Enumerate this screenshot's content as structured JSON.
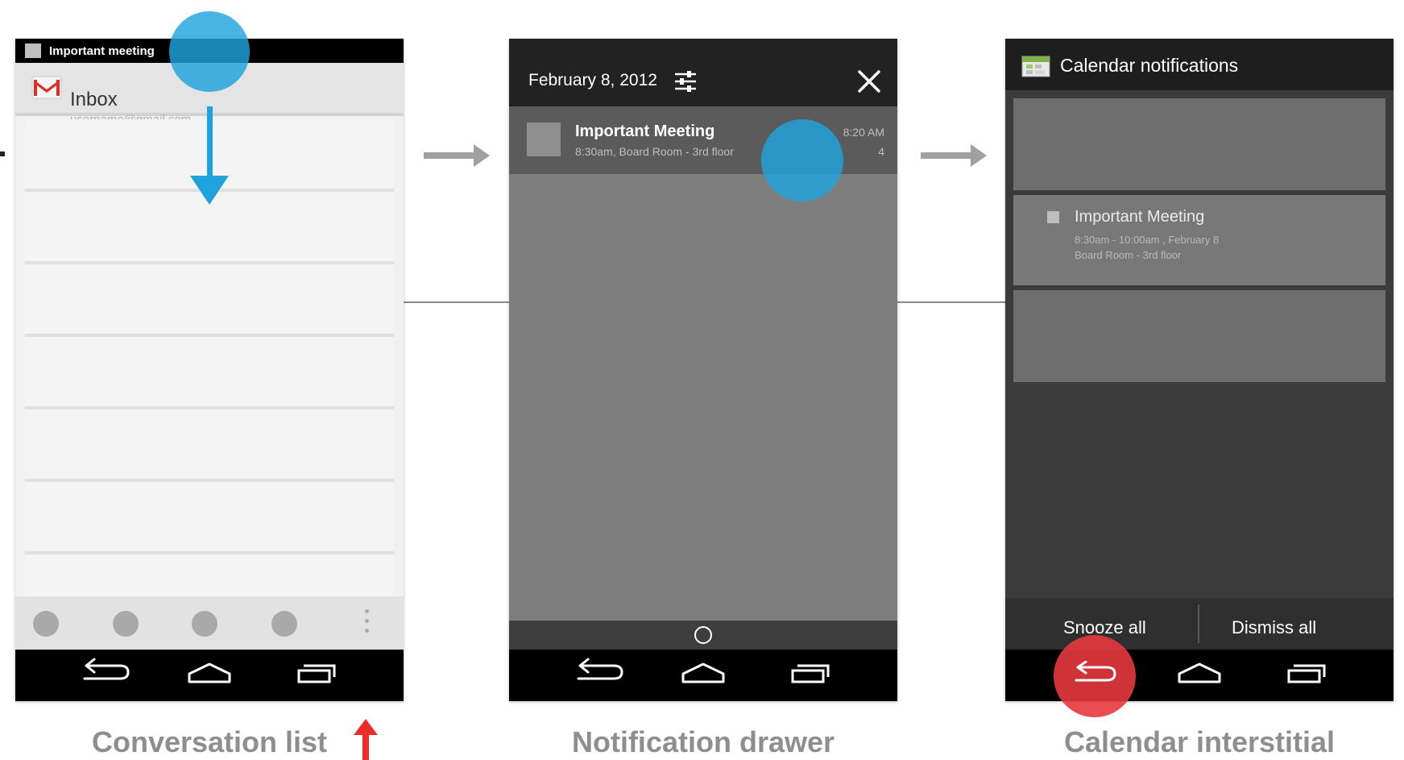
{
  "phones": {
    "conversation_list": {
      "status_text": "Important meeting",
      "title": "Inbox",
      "account": "username@gmail.com",
      "caption": "Conversation list"
    },
    "notification_drawer": {
      "date": "February 8, 2012",
      "notification": {
        "title": "Important Meeting",
        "subtitle": "8:30am, Board Room - 3rd floor",
        "time": "8:20 AM",
        "count": "4"
      },
      "caption": "Notification drawer"
    },
    "calendar_interstitial": {
      "header_title": "Calendar notifications",
      "event": {
        "title": "Important Meeting",
        "time_line": "8:30am - 10:00am , February 8",
        "location_line": "Board Room - 3rd floor"
      },
      "snooze_label": "Snooze all",
      "dismiss_label": "Dismiss all",
      "caption": "Calendar interstitial"
    }
  },
  "colors": {
    "touch": "#1fa3de",
    "back_highlight": "#e6383e",
    "flow_arrow": "#a0a0a0",
    "caption": "#8e8e8e"
  },
  "icons": [
    "gmail-icon",
    "settings-sliders-icon",
    "close-icon",
    "calendar-icon",
    "back-icon",
    "home-icon",
    "recents-icon",
    "arrow-right-icon",
    "arrow-up-icon"
  ]
}
